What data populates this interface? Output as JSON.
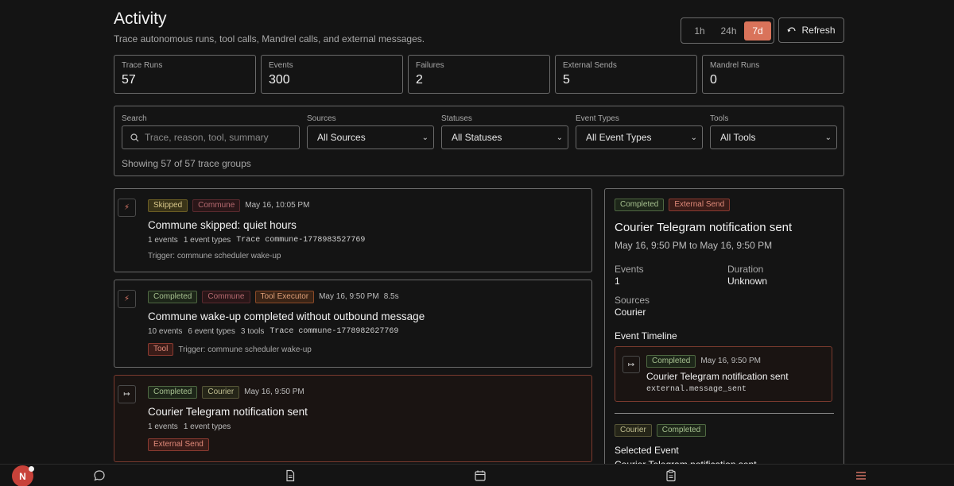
{
  "header": {
    "title": "Activity",
    "subtitle": "Trace autonomous runs, tool calls, Mandrel calls, and external messages."
  },
  "time_range": {
    "options": [
      "1h",
      "24h",
      "7d"
    ],
    "selected": "7d"
  },
  "refresh_label": "Refresh",
  "stats": [
    {
      "label": "Trace Runs",
      "value": "57"
    },
    {
      "label": "Events",
      "value": "300"
    },
    {
      "label": "Failures",
      "value": "2"
    },
    {
      "label": "External Sends",
      "value": "5"
    },
    {
      "label": "Mandrel Runs",
      "value": "0"
    }
  ],
  "filters": {
    "search_label": "Search",
    "search_placeholder": "Trace, reason, tool, summary",
    "sources_label": "Sources",
    "sources_value": "All Sources",
    "statuses_label": "Statuses",
    "statuses_value": "All Statuses",
    "event_types_label": "Event Types",
    "event_types_value": "All Event Types",
    "tools_label": "Tools",
    "tools_value": "All Tools",
    "showing": "Showing 57 of 57 trace groups"
  },
  "cards": [
    {
      "status": "Skipped",
      "source": "Commune",
      "time": "May 16, 10:05 PM",
      "title": "Commune skipped: quiet hours",
      "events": "1 events",
      "event_types": "1 event types",
      "trace": "Trace commune-1778983527769",
      "trigger": "Trigger: commune scheduler wake-up"
    },
    {
      "status": "Completed",
      "source": "Commune",
      "source2": "Tool Executor",
      "time": "May 16, 9:50 PM",
      "duration": "8.5s",
      "title": "Commune wake-up completed without outbound message",
      "events": "10 events",
      "event_types": "6 event types",
      "tools": "3 tools",
      "trace": "Trace commune-1778982627769",
      "tag": "Tool",
      "trigger": "Trigger: commune scheduler wake-up"
    },
    {
      "status": "Completed",
      "source": "Courier",
      "time": "May 16, 9:50 PM",
      "title": "Courier Telegram notification sent",
      "events": "1 events",
      "event_types": "1 event types",
      "tag": "External Send"
    }
  ],
  "detail": {
    "status": "Completed",
    "tag": "External Send",
    "title": "Courier Telegram notification sent",
    "range": "May 16, 9:50 PM to May 16, 9:50 PM",
    "events_label": "Events",
    "events_value": "1",
    "duration_label": "Duration",
    "duration_value": "Unknown",
    "sources_label": "Sources",
    "sources_value": "Courier",
    "timeline_heading": "Event Timeline",
    "timeline": {
      "status": "Completed",
      "time": "May 16, 9:50 PM",
      "title": "Courier Telegram notification sent",
      "event": "external.message_sent"
    },
    "badge_source": "Courier",
    "badge_status": "Completed",
    "selected_heading": "Selected Event",
    "selected_title": "Courier Telegram notification sent"
  },
  "nav": {
    "avatar_initial": "N"
  }
}
